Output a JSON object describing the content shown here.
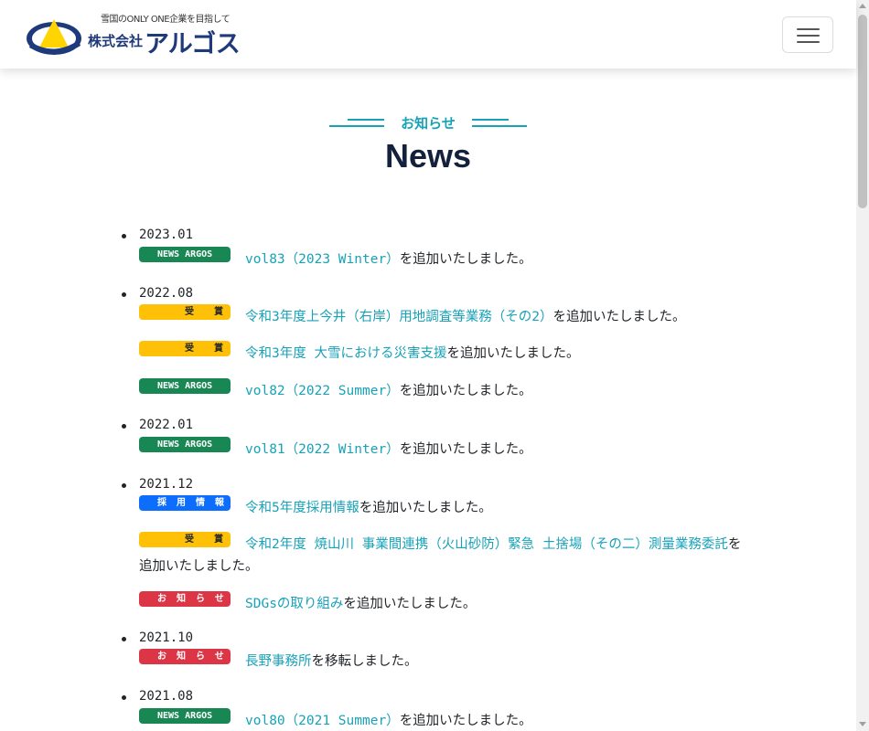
{
  "header": {
    "tagline": "雪国のONLY ONE企業を目指して",
    "company": "株式会社",
    "brand": "アルゴス"
  },
  "section": {
    "subtitle": "お知らせ",
    "title": "News"
  },
  "colors": {
    "accent": "#17a2b8",
    "news_argos": "#198754",
    "award": "#ffc107",
    "recruit": "#0d6efd",
    "notice": "#dc3545"
  },
  "news": {
    "groups": [
      {
        "date": "2023.01",
        "items": [
          {
            "badge": "NEWS ARGOS",
            "link": "vol83（2023 Winter）",
            "text": "を追加いたしました。"
          }
        ]
      },
      {
        "date": "2022.08",
        "items": [
          {
            "badge": "受賞",
            "link": "令和3年度上今井（右岸）用地調査等業務（その2）",
            "text": "を追加いたしました。"
          },
          {
            "badge": "受賞",
            "link": "令和3年度 大雪における災害支援",
            "text": "を追加いたしました。"
          },
          {
            "badge": "NEWS ARGOS",
            "link": "vol82（2022 Summer）",
            "text": "を追加いたしました。"
          }
        ]
      },
      {
        "date": "2022.01",
        "items": [
          {
            "badge": "NEWS ARGOS",
            "link": "vol81（2022 Winter）",
            "text": "を追加いたしました。"
          }
        ]
      },
      {
        "date": "2021.12",
        "items": [
          {
            "badge": "採用情報",
            "link": "令和5年度採用情報",
            "text": "を追加いたしました。"
          },
          {
            "badge": "受賞",
            "link": "令和2年度 焼山川 事業間連携（火山砂防）緊急 土捨場（その二）測量業務委託",
            "text": "を追加いたしました。"
          },
          {
            "badge": "お知らせ",
            "link": "SDGsの取り組み",
            "text": "を追加いたしました。"
          }
        ]
      },
      {
        "date": "2021.10",
        "items": [
          {
            "badge": "お知らせ",
            "link": "長野事務所",
            "text": "を移転しました。"
          }
        ]
      },
      {
        "date": "2021.08",
        "items": [
          {
            "badge": "NEWS ARGOS",
            "link": "vol80（2021 Summer）",
            "text": "を追加いたしました。"
          }
        ]
      }
    ]
  }
}
